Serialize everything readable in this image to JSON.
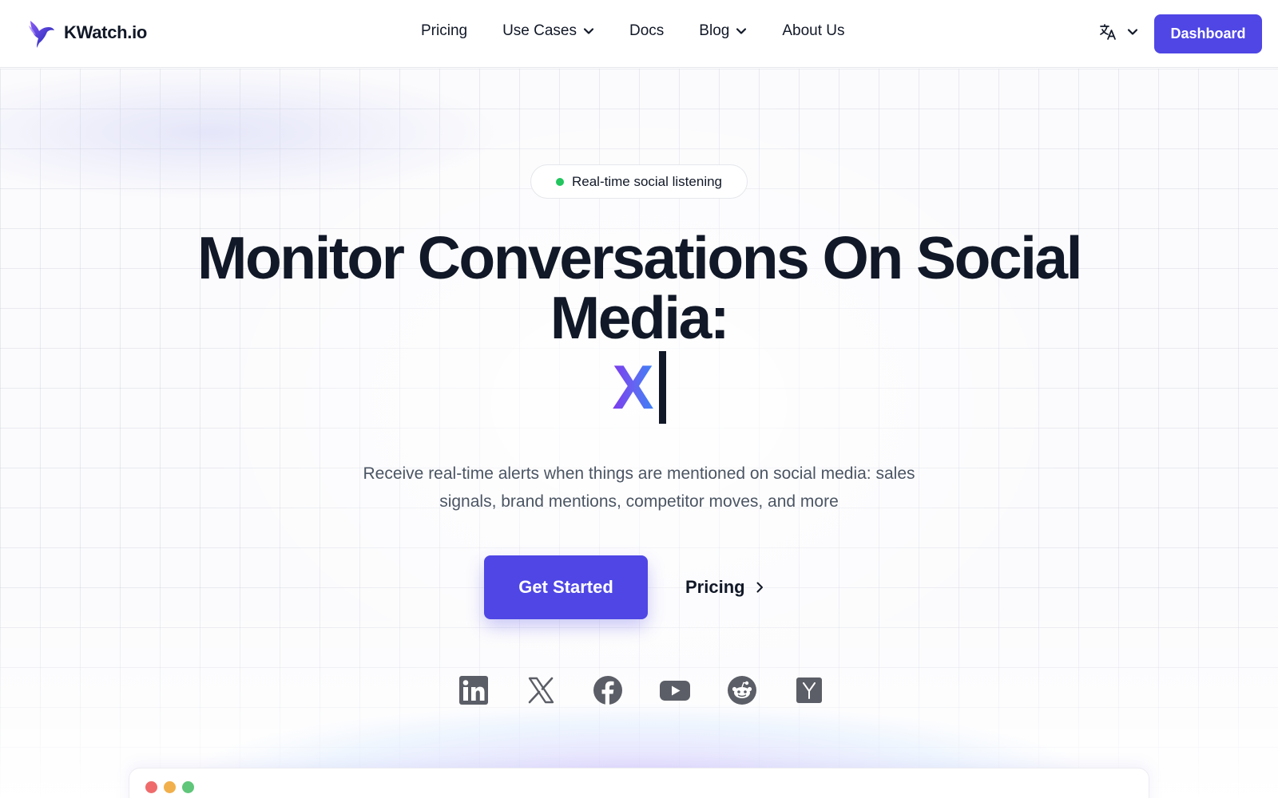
{
  "brand": {
    "name": "KWatch.io"
  },
  "nav": {
    "items": [
      {
        "label": "Pricing",
        "has_dropdown": false
      },
      {
        "label": "Use Cases",
        "has_dropdown": true
      },
      {
        "label": "Docs",
        "has_dropdown": false
      },
      {
        "label": "Blog",
        "has_dropdown": true
      },
      {
        "label": "About Us",
        "has_dropdown": false
      }
    ],
    "language_icon": "translate-icon",
    "dashboard_label": "Dashboard"
  },
  "hero": {
    "badge": "Real-time social listening",
    "headline_line1": "Monitor Conversations On Social",
    "headline_line2": "Media:",
    "typed_word": "X",
    "subtitle_line1": "Receive real-time alerts when things are mentioned on social media: sales",
    "subtitle_line2": "signals, brand mentions, competitor moves, and more",
    "primary_cta": "Get Started",
    "secondary_cta": "Pricing"
  },
  "socials": [
    "linkedin-icon",
    "x-icon",
    "facebook-icon",
    "youtube-icon",
    "reddit-icon",
    "hackernews-icon"
  ],
  "colors": {
    "accent": "#4f46e5",
    "text": "#111827",
    "muted": "#4b5563",
    "live_dot": "#22c55e",
    "icon_gray": "#5b5e66",
    "window_dots": [
      "#ef6b6b",
      "#f1b04c",
      "#5fc67a"
    ]
  }
}
